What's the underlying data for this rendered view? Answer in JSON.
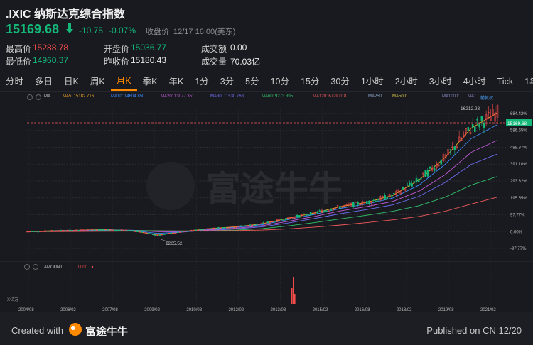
{
  "header": {
    "title": ".IXIC 纳斯达克综合指数",
    "price": "15169.68",
    "change": "-10.75",
    "change_pct": "-0.07%",
    "close_label": "收盘价",
    "close_time": "12/17 16:00(美东)"
  },
  "stats": {
    "high_label": "最高价",
    "high": "15288.78",
    "open_label": "开盘价",
    "open": "15036.77",
    "amount_label": "成交额",
    "amount": "0.00",
    "low_label": "最低价",
    "low": "14960.37",
    "prev_label": "昨收价",
    "prev": "15180.43",
    "volume_label": "成交量",
    "volume": "70.03亿"
  },
  "tabs": [
    "分时",
    "多日",
    "日K",
    "周K",
    "月K",
    "季K",
    "年K",
    "1分",
    "3分",
    "5分",
    "10分",
    "15分",
    "30分",
    "1小时",
    "2小时",
    "3小时",
    "4小时",
    "Tick",
    "1年：日"
  ],
  "active_tab": "月K",
  "ma_bar": {
    "ma": "MA",
    "ma5": "MA5: 15182.716",
    "ma10": "MA10: 14604.850",
    "ma20": "MA20: 13077.351",
    "ma30": "MA30: 11530.768",
    "ma60": "MA60: 9273.395",
    "ma120": "MA120: 6729.018",
    "ma250": "MA250:",
    "ma500": "MA500:",
    "ma1000": "MA1000:",
    "ma1": "MA1",
    "adjust": "前复权"
  },
  "colors": {
    "up": "#ef4b4b",
    "down": "#14b879",
    "ma5": "#f5a623",
    "ma10": "#3d8bff",
    "ma20": "#c25ad9",
    "ma30": "#6e6ef5",
    "ma60": "#32c26a",
    "ma120": "#ef5a5a",
    "ma500": "#d4c14a",
    "accent": "#ff8a00"
  },
  "chart": {
    "y_ticks": [
      "684.42%",
      "586.65%",
      "488.87%",
      "391.10%",
      "293.32%",
      "195.55%",
      "97.77%",
      "0.00%",
      "-97.77%"
    ],
    "current_price_label": "15169.68",
    "max_label": "16212.23",
    "min_label": "1265.52",
    "x_ticks": [
      "2004/08",
      "2006/02",
      "2007/08",
      "2009/02",
      "2010/08",
      "2012/02",
      "2013/08",
      "2015/02",
      "2016/08",
      "2018/02",
      "2019/08",
      "2021/02"
    ],
    "watermark": "富途牛牛"
  },
  "volume_panel": {
    "label": "AMOUNT",
    "value": "0.000",
    "unit": "X亿万"
  },
  "chart_data": {
    "type": "line",
    "x_ticks": [
      "2004/08",
      "2006/02",
      "2007/08",
      "2009/02",
      "2010/08",
      "2012/02",
      "2013/08",
      "2015/02",
      "2016/08",
      "2018/02",
      "2019/08",
      "2021/02"
    ],
    "ylim_pct": [
      -97.77,
      684.42
    ],
    "series": [
      {
        "name": "MA5",
        "values": [
          0,
          5,
          8,
          12,
          6,
          -20,
          0,
          18,
          28,
          45,
          78,
          108,
          145,
          170,
          210,
          300,
          430,
          600,
          690
        ]
      },
      {
        "name": "MA10",
        "values": [
          0,
          4,
          7,
          10,
          7,
          -10,
          -2,
          14,
          25,
          40,
          70,
          100,
          135,
          160,
          195,
          270,
          390,
          540,
          620
        ]
      },
      {
        "name": "MA20",
        "values": [
          0,
          3,
          6,
          8,
          8,
          0,
          -2,
          10,
          20,
          34,
          60,
          88,
          120,
          145,
          175,
          235,
          330,
          460,
          530
        ]
      },
      {
        "name": "MA30",
        "values": [
          0,
          2,
          5,
          7,
          8,
          4,
          0,
          7,
          16,
          28,
          50,
          76,
          104,
          128,
          155,
          205,
          285,
          390,
          450
        ]
      },
      {
        "name": "MA60",
        "values": [
          0,
          1,
          3,
          5,
          6,
          5,
          4,
          5,
          9,
          17,
          33,
          52,
          74,
          95,
          118,
          150,
          200,
          270,
          320
        ]
      },
      {
        "name": "MA120",
        "values": [
          0,
          0,
          1,
          2,
          3,
          4,
          4,
          5,
          6,
          9,
          16,
          26,
          38,
          52,
          68,
          88,
          118,
          160,
          200
        ]
      }
    ],
    "annotations": [
      {
        "label": "16212.23",
        "kind": "max"
      },
      {
        "label": "1265.52",
        "kind": "min"
      }
    ]
  }
}
